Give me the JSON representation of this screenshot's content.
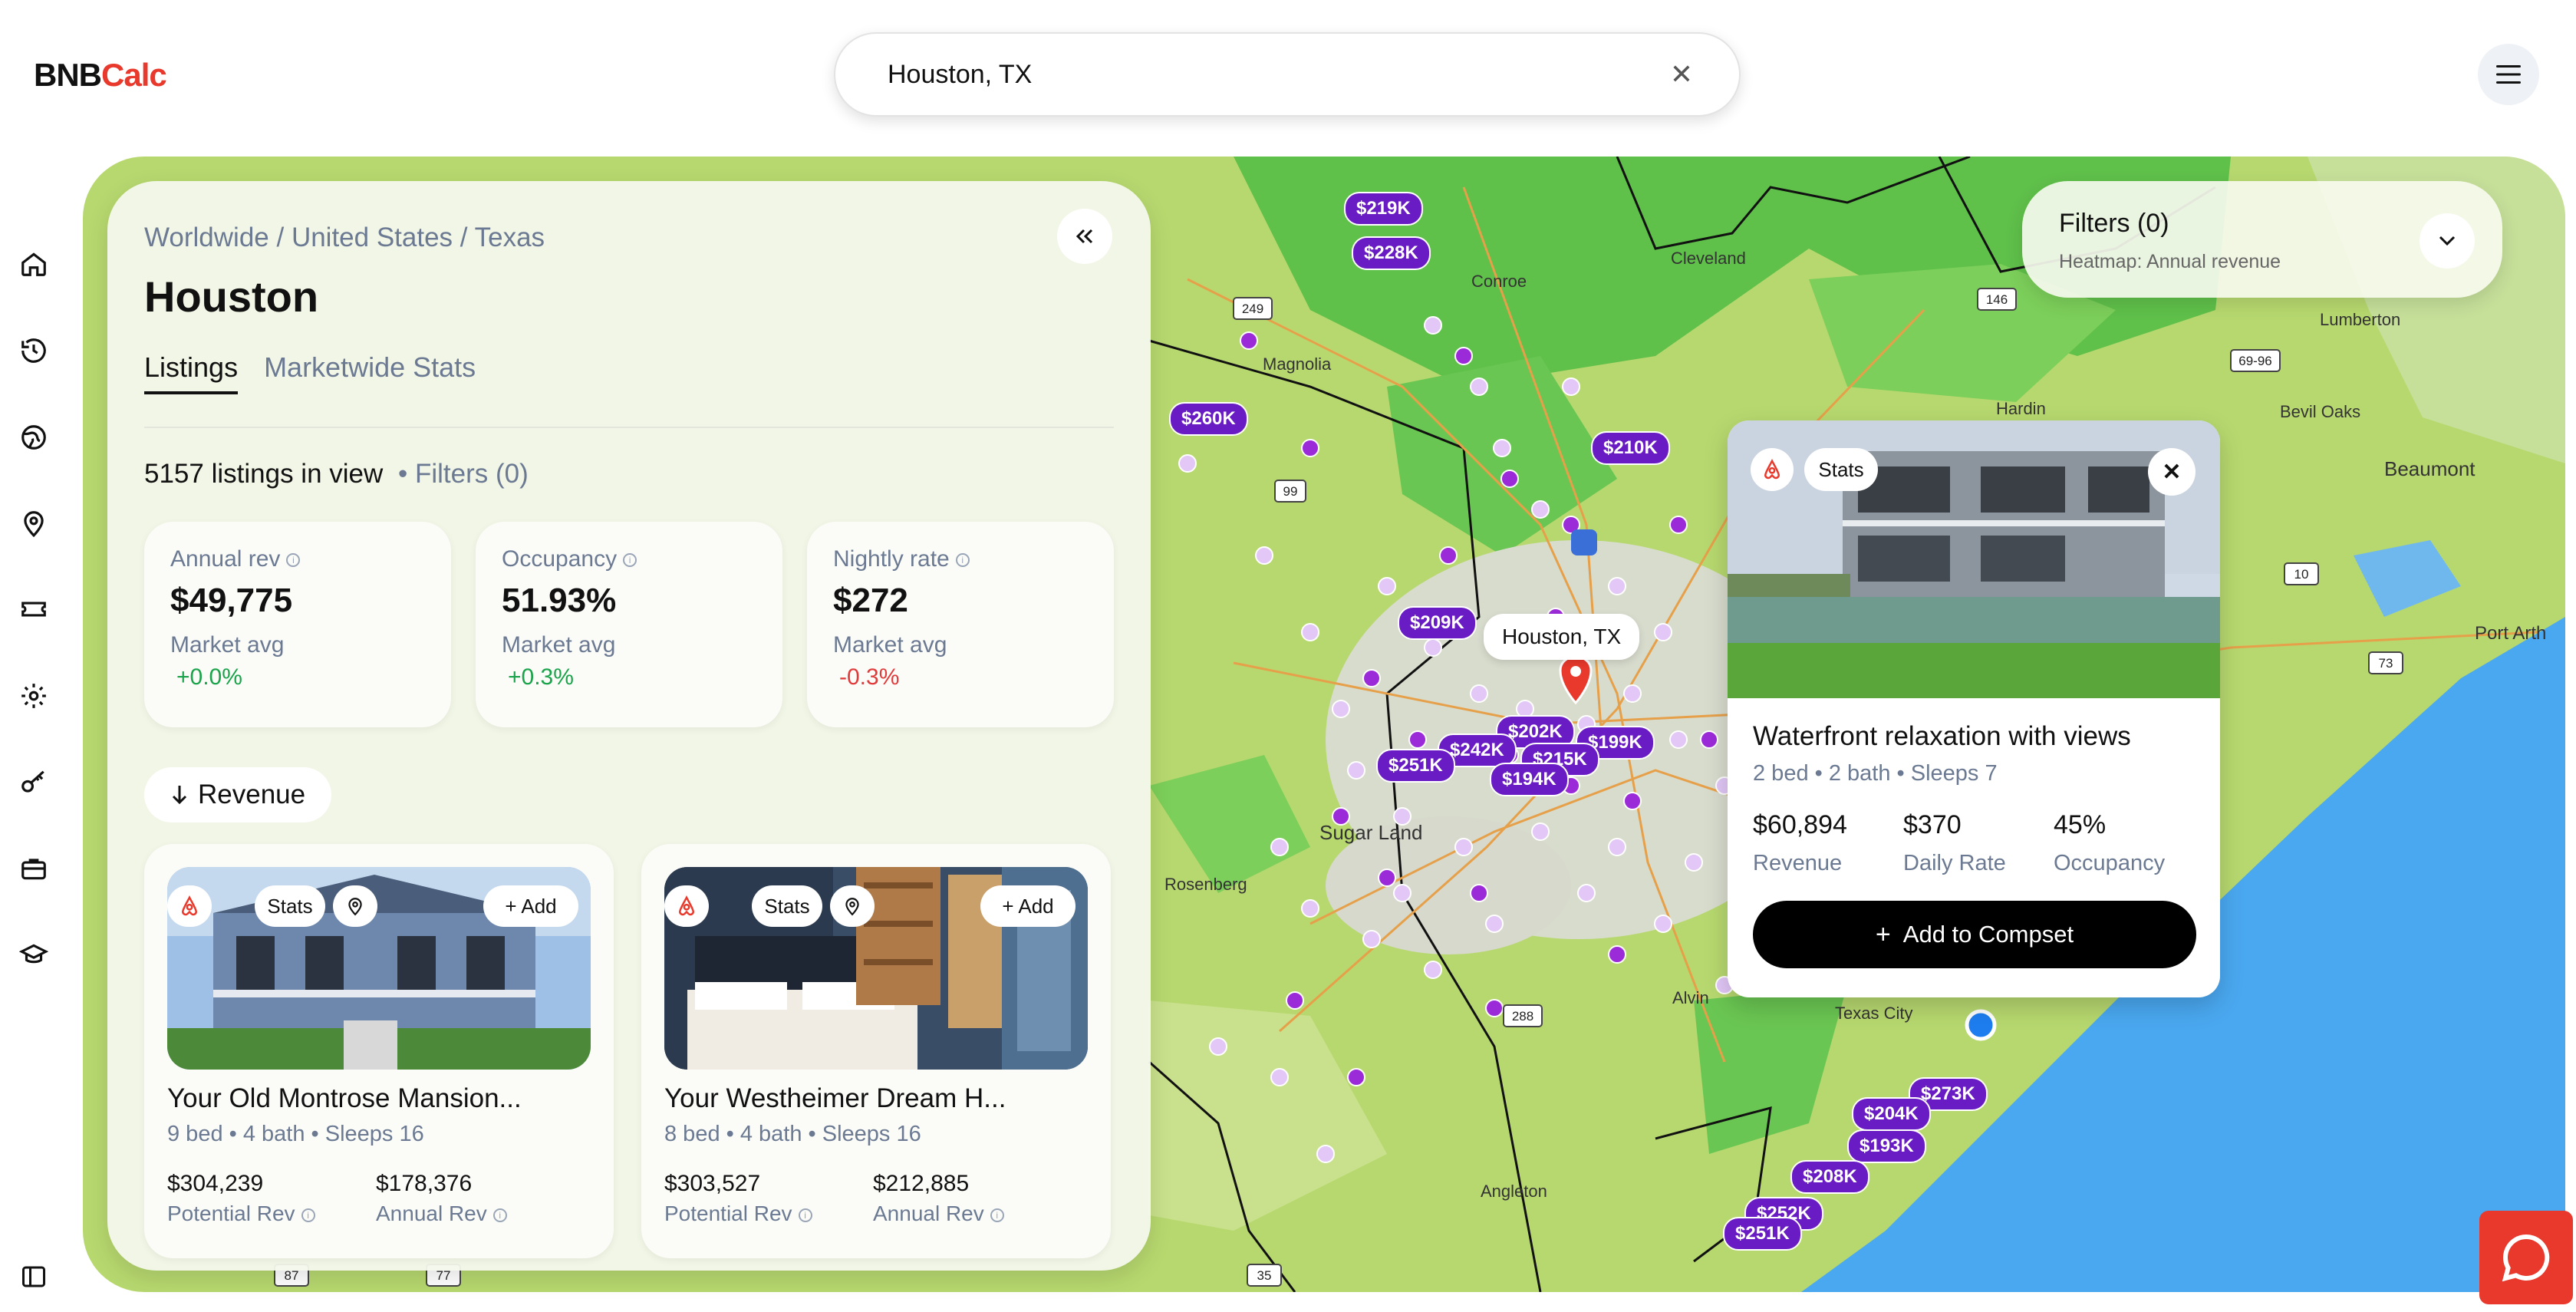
{
  "logo": {
    "part1": "BNB",
    "part2": "Calc"
  },
  "search": {
    "value": "Houston, TX"
  },
  "breadcrumb": {
    "a": "Worldwide",
    "sep1": " / ",
    "b": "United States",
    "sep2": " / ",
    "c": "Texas"
  },
  "city": "Houston",
  "tabs": {
    "listings": "Listings",
    "marketwide": "Marketwide Stats"
  },
  "listing_count": "5157 listings in view",
  "filters_link": "• Filters (0)",
  "stats": [
    {
      "label": "Annual rev",
      "value": "$49,775",
      "market_label": "Market avg",
      "delta": "+0.0%",
      "trend": "positive"
    },
    {
      "label": "Occupancy",
      "value": "51.93%",
      "market_label": "Market avg",
      "delta": "+0.3%",
      "trend": "positive"
    },
    {
      "label": "Nightly rate",
      "value": "$272",
      "market_label": "Market avg",
      "delta": "-0.3%",
      "trend": "negative"
    }
  ],
  "sort": {
    "label": "Revenue"
  },
  "cards": [
    {
      "title": "Your Old Montrose Mansion...",
      "details": "9 bed • 4 bath • Sleeps 16",
      "potential_value": "$304,239",
      "potential_label": "Potential Rev",
      "annual_value": "$178,376",
      "annual_label": "Annual Rev",
      "stats_label": "Stats",
      "add_label": "+ Add"
    },
    {
      "title": "Your Westheimer Dream H...",
      "details": "8 bed • 4 bath • Sleeps 16",
      "potential_value": "$303,527",
      "potential_label": "Potential Rev",
      "annual_value": "$212,885",
      "annual_label": "Annual Rev",
      "stats_label": "Stats",
      "add_label": "+ Add"
    }
  ],
  "filters_panel": {
    "title": "Filters (0)",
    "subtitle": "Heatmap: Annual revenue"
  },
  "popup": {
    "stats_label": "Stats",
    "title": "Waterfront relaxation with views",
    "details": "2 bed • 2 bath • Sleeps 7",
    "revenue_value": "$60,894",
    "revenue_label": "Revenue",
    "rate_value": "$370",
    "rate_label": "Daily Rate",
    "occupancy_value": "45%",
    "occupancy_label": "Occupancy",
    "compset_label": "Add to Compset"
  },
  "map": {
    "pin_label": "Houston, TX",
    "places": [
      "Cleveland",
      "Magnolia",
      "Conroe",
      "Lumberton",
      "Bevil Oaks",
      "Beaumont",
      "Port Arth",
      "Hardin",
      "Sugar Land",
      "Rosenberg",
      "Alvin",
      "Angleton",
      "Texas City"
    ],
    "route_shields": [
      "249",
      "146",
      "69-96",
      "99",
      "288",
      "10",
      "73",
      "87",
      "77",
      "35"
    ],
    "price_pills": [
      "$219K",
      "$228K",
      "$260K",
      "$210K",
      "$209K",
      "$202K",
      "$199K",
      "$242K",
      "$251K",
      "$215K",
      "$194K",
      "$273K",
      "$204K",
      "$193K",
      "$208K",
      "$252K",
      "$251K"
    ]
  },
  "colors": {
    "brand_red": "#e8392c",
    "pill_purple": "#6a1cc4",
    "water": "#4aa8f0",
    "land": "#b7d86f"
  }
}
